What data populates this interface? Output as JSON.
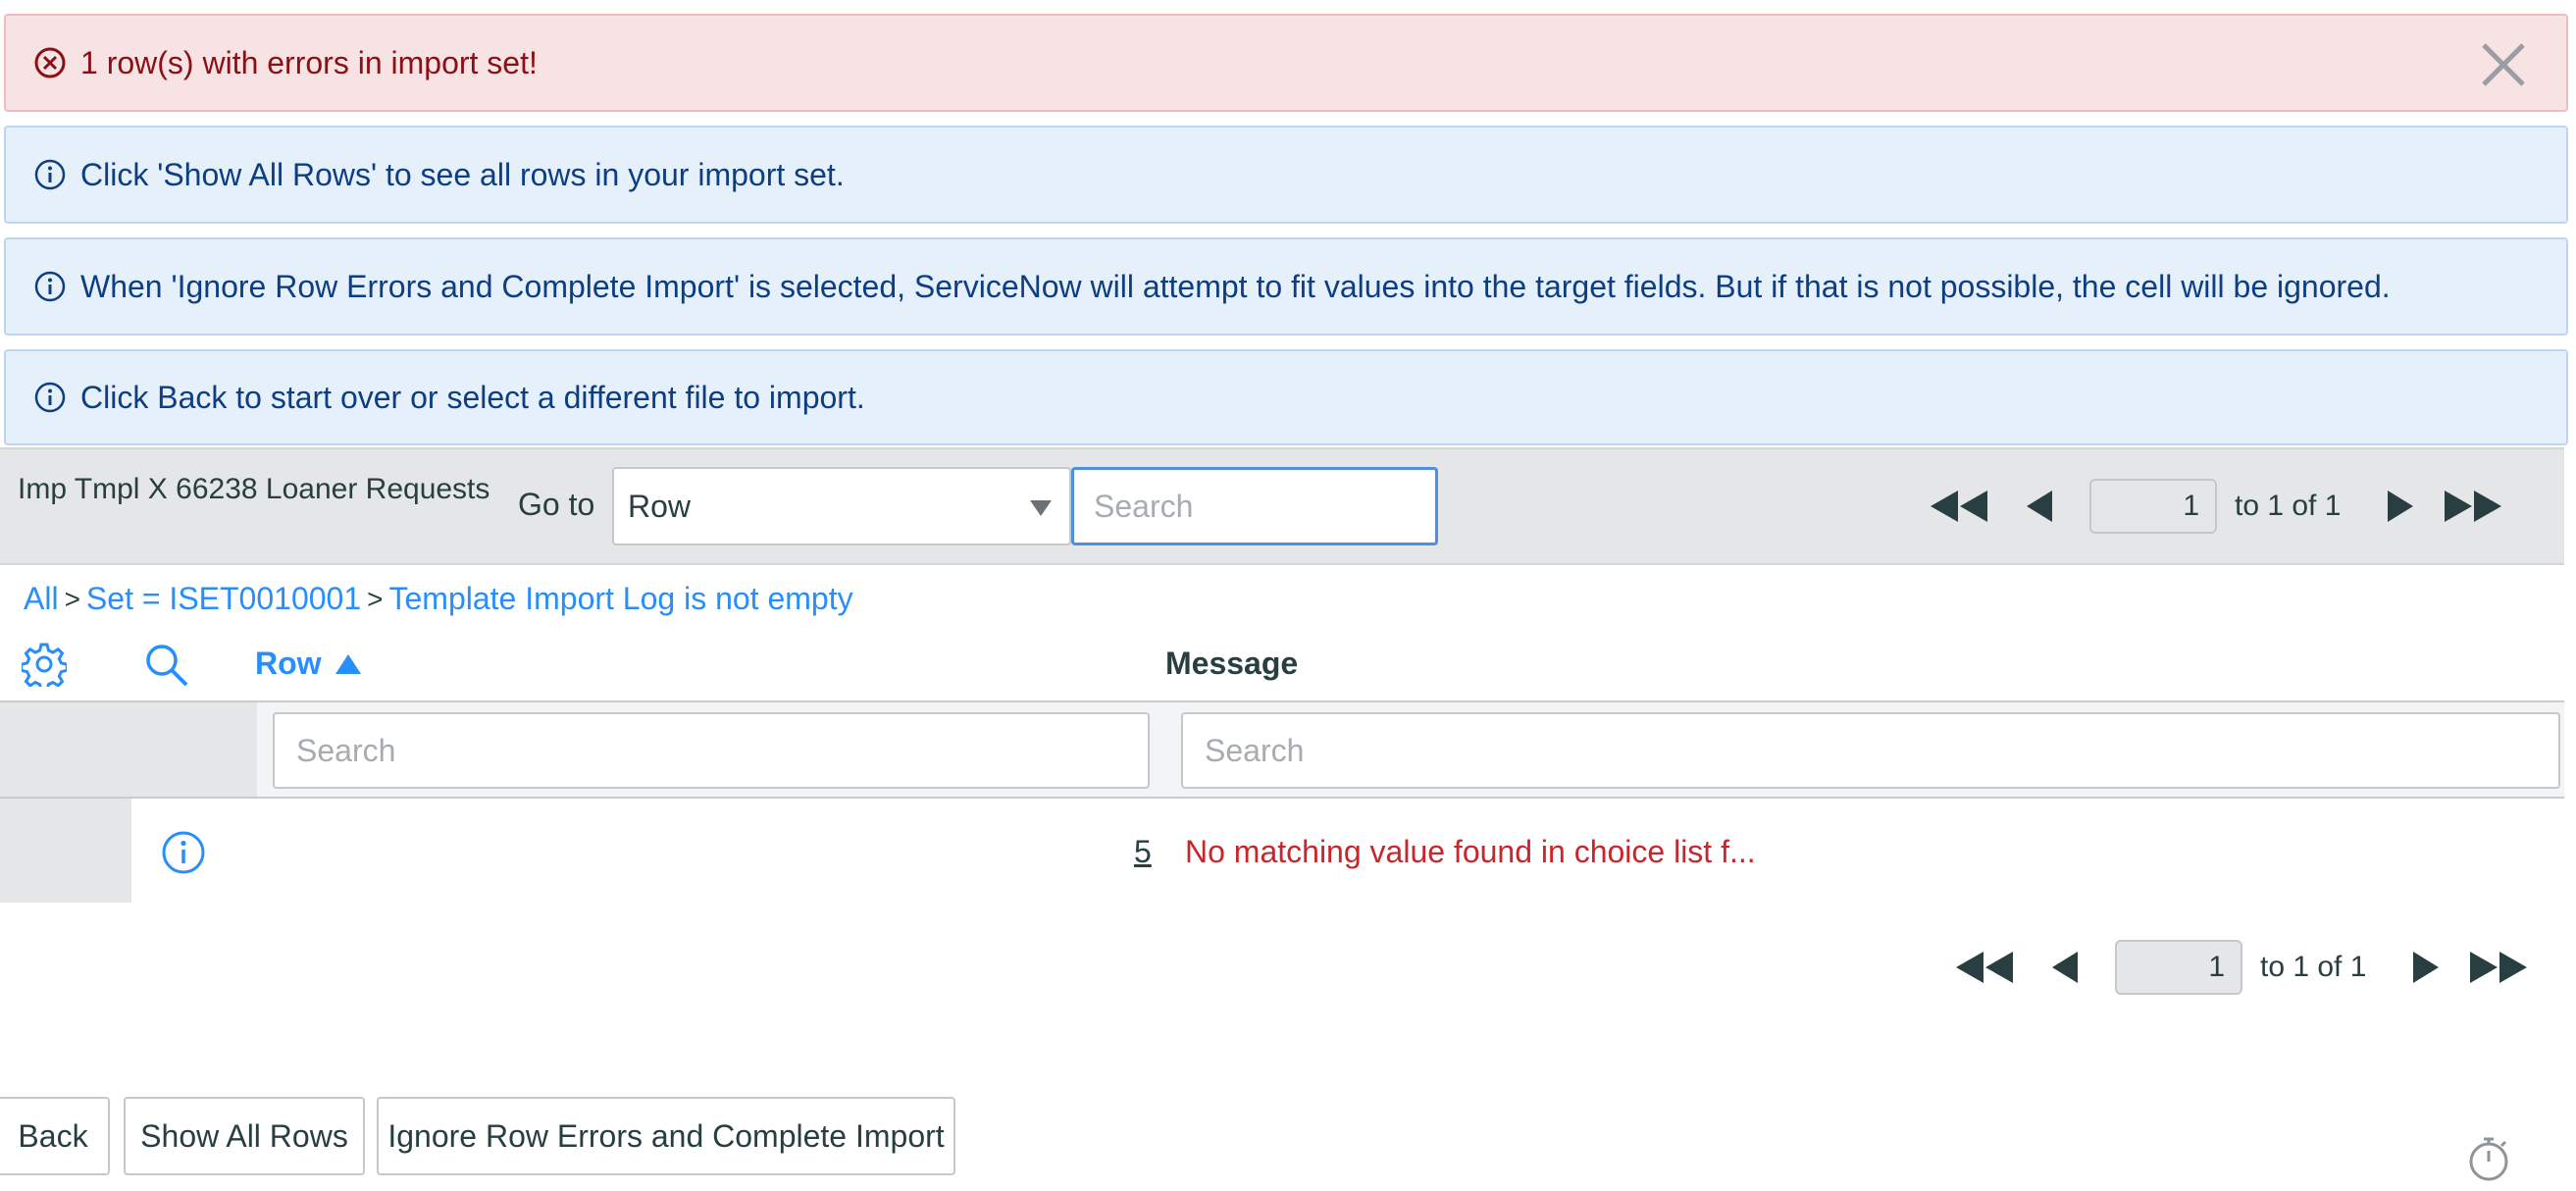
{
  "alerts": {
    "error": "1 row(s) with errors in import set!",
    "info": [
      "Click 'Show All Rows' to see all rows in your import set.",
      "When 'Ignore Row Errors and Complete Import' is selected, ServiceNow will attempt to fit values into the target fields. But if that is not possible, the cell will be ignored.",
      "Click Back to start over or select a different file to import."
    ]
  },
  "list": {
    "title": "Imp Tmpl X 66238 Loaner Requests",
    "goto_label": "Go to",
    "goto_field": "Row",
    "search_placeholder": "Search"
  },
  "pagination": {
    "page": "1",
    "count": "to 1 of 1"
  },
  "breadcrumb": {
    "all": "All",
    "sep": ">",
    "set": "Set = ISET0010001",
    "condition": "Template Import Log is not empty"
  },
  "columns": {
    "row": "Row",
    "message": "Message",
    "search_placeholder": "Search"
  },
  "rows": [
    {
      "row": "5",
      "message": "No matching value found in choice list f..."
    }
  ],
  "buttons": {
    "back": "Back",
    "show_all": "Show All Rows",
    "ignore": "Ignore Row Errors and Complete Import"
  },
  "colors": {
    "error_text": "#8a1016",
    "info_text": "#0e3e82",
    "link": "#278efc",
    "error_message": "#c8262c"
  }
}
